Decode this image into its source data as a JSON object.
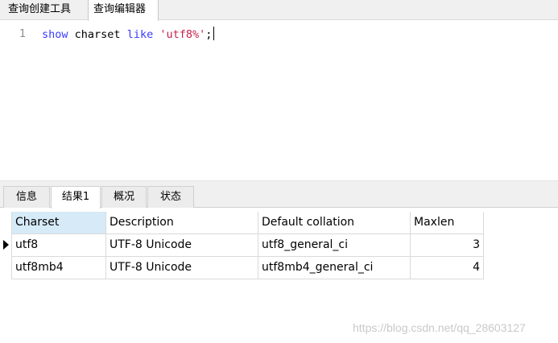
{
  "top_tabs": [
    "查询创建工具",
    "查询编辑器"
  ],
  "editor": {
    "line_number": "1",
    "tokens": {
      "kw1": "show",
      "sp1": " ",
      "id1": "charset",
      "sp2": " ",
      "kw2": "like",
      "sp3": " ",
      "str1": "'utf8%'",
      "semi": ";"
    }
  },
  "result_tabs": [
    "信息",
    "结果1",
    "概况",
    "状态"
  ],
  "grid": {
    "columns": [
      "Charset",
      "Description",
      "Default collation",
      "Maxlen"
    ],
    "rows": [
      [
        "utf8",
        "UTF-8 Unicode",
        "utf8_general_ci",
        "3"
      ],
      [
        "utf8mb4",
        "UTF-8 Unicode",
        "utf8mb4_general_ci",
        "4"
      ]
    ]
  },
  "watermark": "https://blog.csdn.net/qq_28603127",
  "colors": {
    "keyword": "#3a3aff",
    "string": "#c81e4a",
    "selected_header": "#d6eaf8"
  }
}
